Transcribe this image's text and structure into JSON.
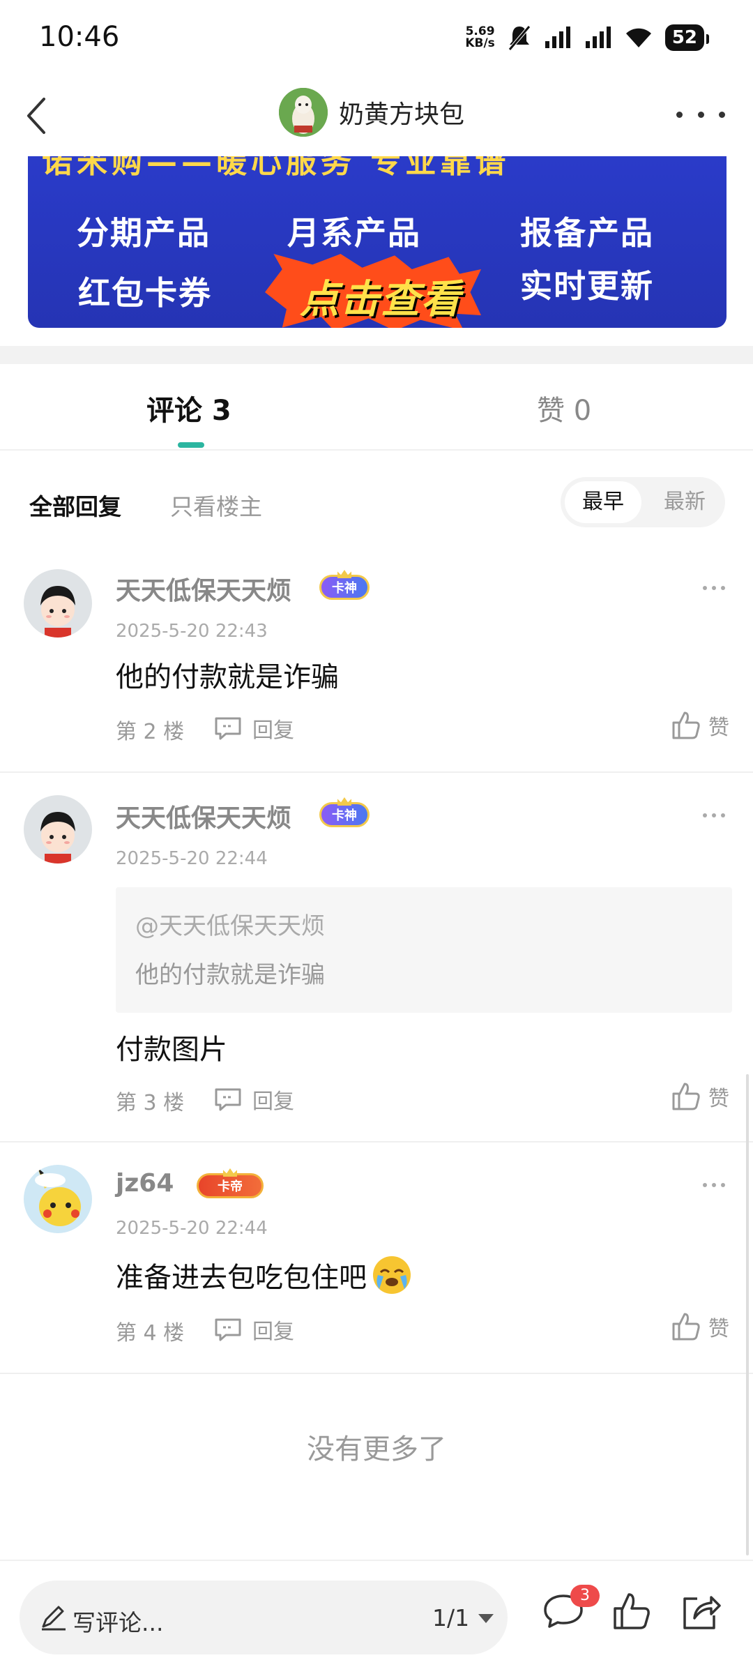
{
  "status_bar": {
    "time": "10:46",
    "net_speed_value": "5.69",
    "net_speed_unit": "KB/s",
    "battery": "52"
  },
  "header": {
    "username": "奶黄方块包"
  },
  "banner": {
    "top_text": "诺米购——暖心服务 专业靠谱",
    "items": [
      "分期产品",
      "月系产品",
      "报备产品",
      "红包卡券",
      "实时更新"
    ],
    "cta": "点击查看"
  },
  "tabs": {
    "comments_label": "评论 3",
    "likes_label": "赞 0"
  },
  "filter": {
    "all": "全部回复",
    "owner_only": "只看楼主",
    "sort_earliest": "最早",
    "sort_latest": "最新"
  },
  "comments": [
    {
      "name": "天天低保天天烦",
      "badge": "卡神",
      "time": "2025-5-20 22:43",
      "text": "他的付款就是诈骗",
      "floor": "第 2 楼",
      "reply": "回复",
      "like": "赞"
    },
    {
      "name": "天天低保天天烦",
      "badge": "卡神",
      "time": "2025-5-20 22:44",
      "quote_at": "@天天低保天天烦",
      "quote_text": "他的付款就是诈骗",
      "text": "付款图片",
      "floor": "第 3 楼",
      "reply": "回复",
      "like": "赞"
    },
    {
      "name": "jz64",
      "badge": "卡帝",
      "time": "2025-5-20 22:44",
      "text": "准备进去包吃包住吧",
      "floor": "第 4 楼",
      "reply": "回复",
      "like": "赞"
    }
  ],
  "no_more": "没有更多了",
  "bottom_bar": {
    "placeholder": "写评论...",
    "page": "1/1",
    "comment_count": "3"
  },
  "icons": [
    "back-icon",
    "more-icon",
    "reply-icon",
    "thumb-up-icon",
    "pencil-icon",
    "comment-icon",
    "share-icon",
    "crying-emoji-icon"
  ],
  "colors": {
    "accent": "#2bb5a0",
    "badge_red": "#ee4a4a",
    "banner_blue": "#2a3bc9"
  }
}
